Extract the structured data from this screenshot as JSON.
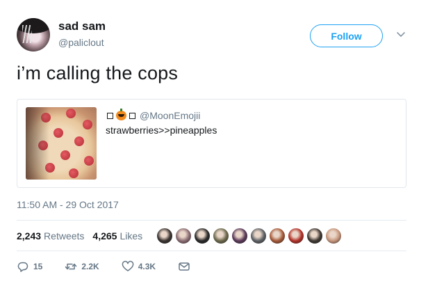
{
  "author": {
    "display_name": "sad sam",
    "handle": "@paliclout"
  },
  "follow_label": "Follow",
  "tweet_text": "i’m calling the cops",
  "quoted": {
    "handle": "@MoonEmojii",
    "text": "strawberries>>pineapples"
  },
  "timestamp": "11:50 AM - 29 Oct 2017",
  "stats": {
    "retweets_count": "2,243",
    "retweets_label": "Retweets",
    "likes_count": "4,265",
    "likes_label": "Likes"
  },
  "liker_avatars": [
    "#3b3533",
    "#8c6f76",
    "#2b2a2a",
    "#6d6a4e",
    "#5c3b5a",
    "#5e6266",
    "#a65a3a",
    "#b33229",
    "#403934",
    "#c7977d"
  ],
  "actions": {
    "reply_count": "15",
    "retweet_count": "2.2K",
    "like_count": "4.3K"
  },
  "colors": {
    "accent": "#1da1f2",
    "text": "#14171a",
    "muted": "#657786",
    "border": "#e1e8ed"
  },
  "icons": [
    "caret-down-icon",
    "reply-icon",
    "retweet-icon",
    "like-icon",
    "message-icon"
  ]
}
